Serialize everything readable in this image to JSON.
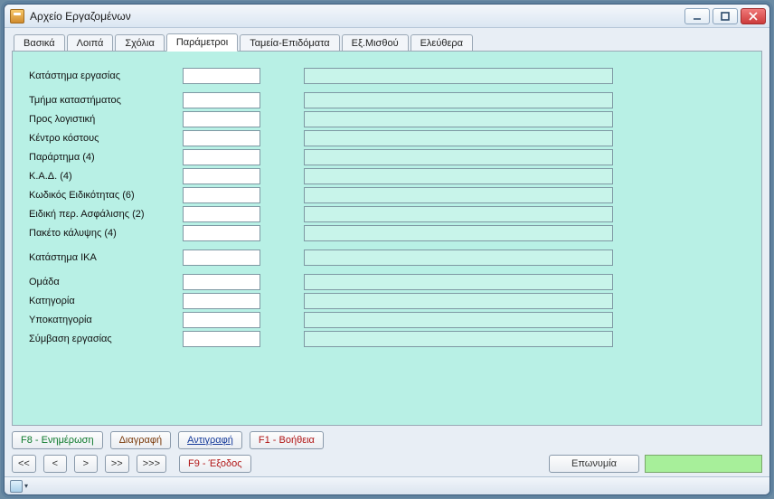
{
  "window": {
    "title": "Αρχείο Εργαζομένων"
  },
  "tabs": [
    {
      "label": "Βασικά"
    },
    {
      "label": "Λοιπά"
    },
    {
      "label": "Σχόλια"
    },
    {
      "label": "Παράμετροι"
    },
    {
      "label": "Ταμεία-Επιδόματα"
    },
    {
      "label": "Εξ.Μισθού"
    },
    {
      "label": "Ελεύθερα"
    }
  ],
  "active_tab_index": 3,
  "fields": [
    {
      "label": "Κατάστημα εργασίας",
      "short": "",
      "long": "",
      "spaced": false
    },
    {
      "label": "Τμήμα καταστήματος",
      "short": "",
      "long": "",
      "spaced": true
    },
    {
      "label": "Προς λογιστική",
      "short": "",
      "long": "",
      "spaced": false
    },
    {
      "label": "Κέντρο κόστους",
      "short": "",
      "long": "",
      "spaced": false
    },
    {
      "label": "Παράρτημα (4)",
      "short": "",
      "long": "",
      "spaced": false
    },
    {
      "label": "Κ.Α.Δ. (4)",
      "short": "",
      "long": "",
      "spaced": false
    },
    {
      "label": "Κωδικός Ειδικότητας (6)",
      "short": "",
      "long": "",
      "spaced": false
    },
    {
      "label": "Ειδική περ. Ασφάλισης (2)",
      "short": "",
      "long": "",
      "spaced": false
    },
    {
      "label": "Πακέτο κάλυψης (4)",
      "short": "",
      "long": "",
      "spaced": false
    },
    {
      "label": "Κατάστημα ΙΚΑ",
      "short": "",
      "long": "",
      "spaced": true
    },
    {
      "label": "Ομάδα",
      "short": "",
      "long": "",
      "spaced": true
    },
    {
      "label": "Κατηγορία",
      "short": "",
      "long": "",
      "spaced": false
    },
    {
      "label": "Υποκατηγορία",
      "short": "",
      "long": "",
      "spaced": false
    },
    {
      "label": "Σύμβαση εργασίας",
      "short": "",
      "long": "",
      "spaced": false
    }
  ],
  "buttons": {
    "update": "F8 - Ενημέρωση",
    "delete": "Διαγραφή",
    "copy": "Αντιγραφή",
    "help": "F1 - Βοήθεια",
    "exit": "F9 - Έξοδος",
    "name_label": "Επωνυμία",
    "name_value": ""
  },
  "nav": {
    "first": "<<",
    "prev": "<",
    "next": ">",
    "last": ">>",
    "more": ">>>"
  }
}
